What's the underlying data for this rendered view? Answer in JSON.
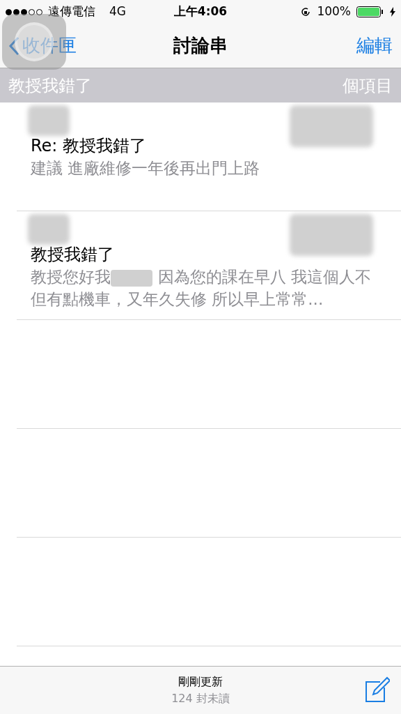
{
  "status_bar": {
    "carrier": "遠傳電信",
    "network": "4G",
    "time": "上午4:06",
    "battery": "100%",
    "charging": true
  },
  "nav": {
    "back": "收件匣",
    "title": "討論串",
    "action": "編輯"
  },
  "thread_header": {
    "subject": "教授我錯了",
    "count": "個項目"
  },
  "messages": [
    {
      "subject": "Re: 教授我錯了",
      "preview_parts": [
        "建議 進廠維修一年後再出門上路"
      ]
    },
    {
      "subject": "教授我錯了",
      "preview_parts": [
        "教授您好我",
        "因為您的課在早八 我這個人不但有點機車，又年久失修 所以早上常常..."
      ]
    }
  ],
  "toolbar": {
    "status": "剛剛更新",
    "unread": "124 封未讀"
  }
}
